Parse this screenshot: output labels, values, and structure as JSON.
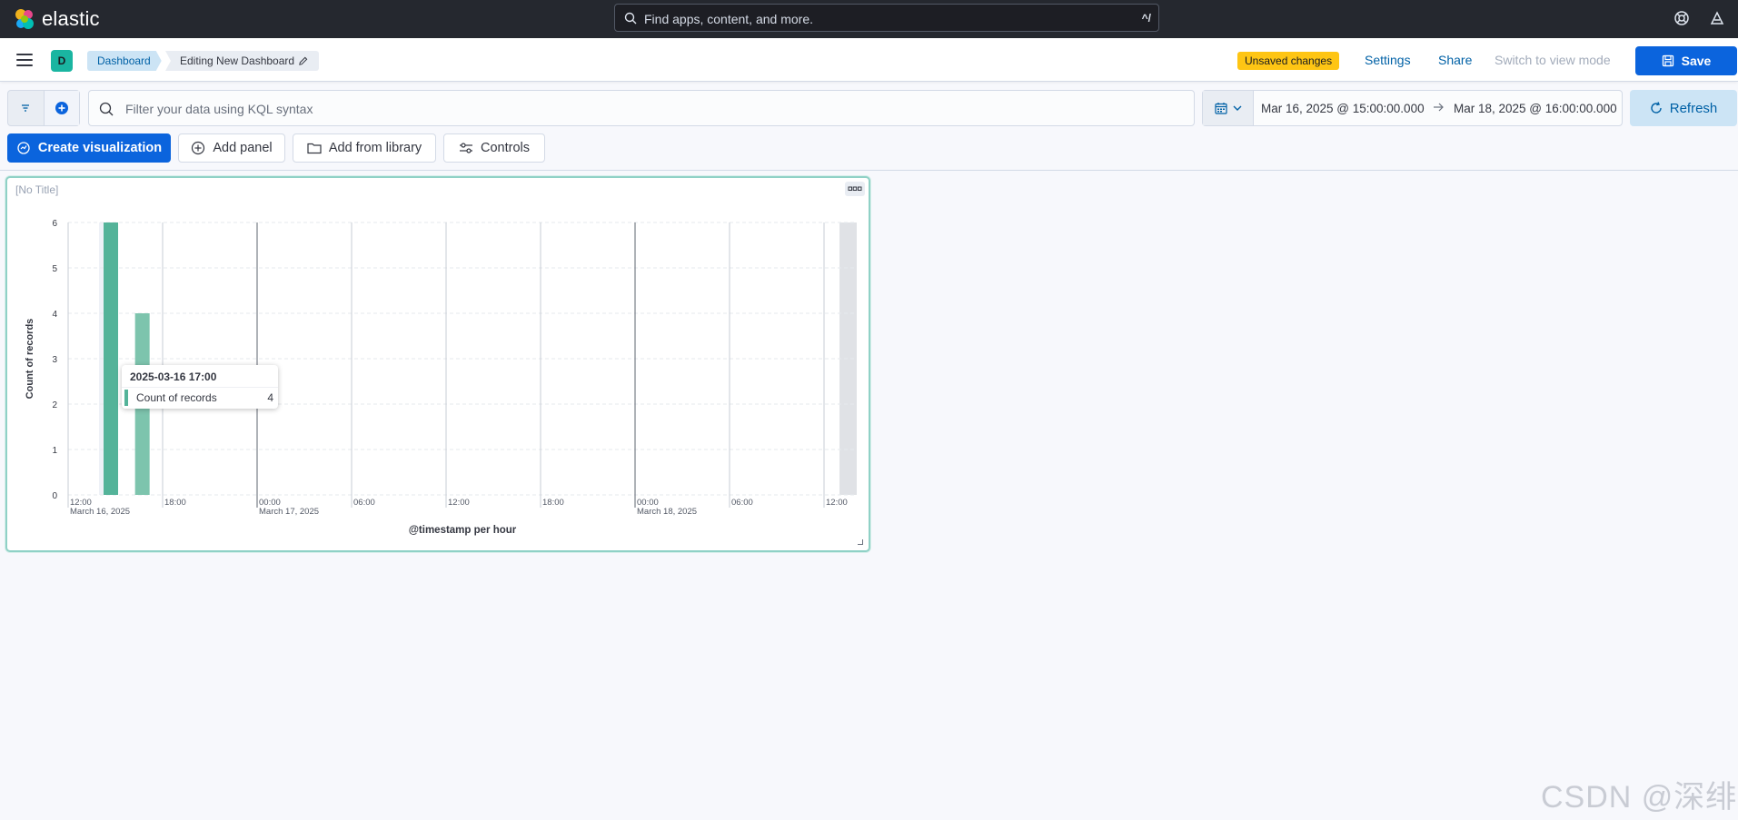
{
  "app": {
    "logo_text": "elastic",
    "search_placeholder": "Find apps, content, and more.",
    "search_shortcut": "^/"
  },
  "header": {
    "space_initial": "D",
    "breadcrumbs": [
      "Dashboard",
      "Editing New Dashboard"
    ],
    "unsaved_badge": "Unsaved changes",
    "settings": "Settings",
    "share": "Share",
    "switch_view": "Switch to view mode",
    "save": "Save"
  },
  "query": {
    "placeholder": "Filter your data using KQL syntax",
    "date_start": "Mar 16, 2025 @ 15:00:00.000",
    "date_end": "Mar 18, 2025 @ 16:00:00.000",
    "refresh": "Refresh"
  },
  "actions": {
    "create_visualization": "Create visualization",
    "add_panel": "Add panel",
    "add_from_library": "Add from library",
    "controls": "Controls"
  },
  "panel": {
    "title": "[No Title]"
  },
  "chart_data": {
    "type": "bar",
    "xlabel": "@timestamp per hour",
    "ylabel": "Count of records",
    "ylim": [
      0,
      6
    ],
    "y_ticks": [
      "0",
      "1",
      "2",
      "3",
      "4",
      "5",
      "6"
    ],
    "x_ticks": [
      {
        "label": "12:00",
        "sub": "March 16, 2025"
      },
      {
        "label": "18:00",
        "sub": ""
      },
      {
        "label": "00:00",
        "sub": "March 17, 2025"
      },
      {
        "label": "06:00",
        "sub": ""
      },
      {
        "label": "12:00",
        "sub": ""
      },
      {
        "label": "18:00",
        "sub": ""
      },
      {
        "label": "00:00",
        "sub": "March 18, 2025"
      },
      {
        "label": "06:00",
        "sub": ""
      },
      {
        "label": "12:00",
        "sub": ""
      }
    ],
    "series": [
      {
        "name": "Count of records",
        "color": "#54b399",
        "points": [
          {
            "x": "2025-03-16 15:00",
            "y": 6
          },
          {
            "x": "2025-03-16 17:00",
            "y": 4
          }
        ]
      }
    ],
    "grid": true,
    "tooltip": {
      "title": "2025-03-16 17:00",
      "label": "Count of records",
      "value": "4"
    }
  },
  "watermark": "CSDN @深绯"
}
